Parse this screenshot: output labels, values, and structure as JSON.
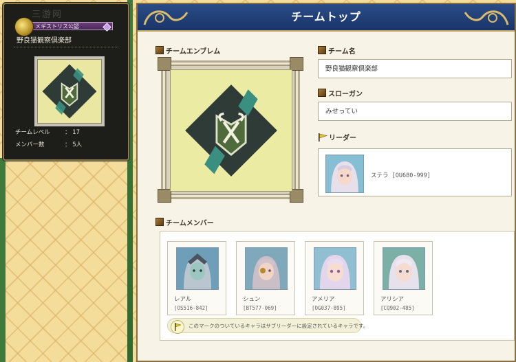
{
  "team_card": {
    "tag_label": "メギストリス公認",
    "team_name": "野良猫観察倶楽部",
    "level_label": "チームレベル",
    "level_value": "： 17",
    "members_label": "メンバー数",
    "members_value": "： 5人",
    "watermark": "三游网"
  },
  "header": {
    "title": "チームトップ"
  },
  "sections": {
    "emblem": "チームエンブレム",
    "name": "チーム名",
    "slogan": "スローガン",
    "leader": "リーダー",
    "members": "チームメンバー"
  },
  "team": {
    "name": "野良猫観察倶楽部",
    "slogan": "みせってい"
  },
  "leader": {
    "name": "ステラ [OU680-999]"
  },
  "members": [
    {
      "name": "レアル",
      "id": "[OS516-842]"
    },
    {
      "name": "シュン",
      "id": "[BT577-069]"
    },
    {
      "name": "アメリア",
      "id": "[OG037-895]"
    },
    {
      "name": "アリシア",
      "id": "[CQ902-485]"
    }
  ],
  "note": "このマークのついているキャラはサブリーダーに設定されているキャラです。",
  "colors": {
    "header_blue": "#1f3f7a",
    "emblem_background": "#eceba4",
    "emblem_dark": "#2f3b36",
    "emblem_teal": "#3a8f80"
  }
}
